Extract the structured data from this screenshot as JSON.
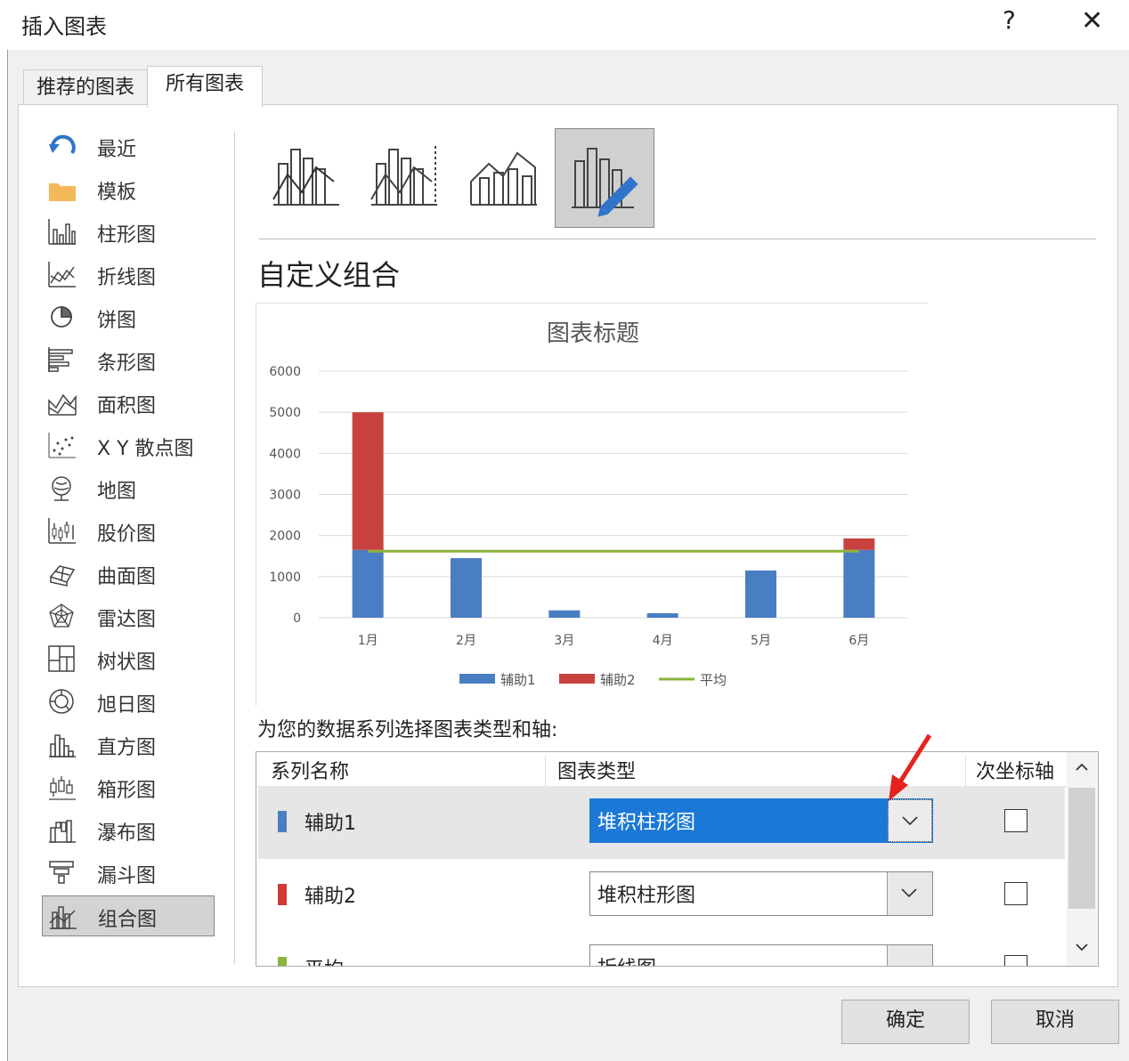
{
  "dialog": {
    "title": "插入图表",
    "help": "?",
    "close": "✕"
  },
  "tabs": [
    {
      "label": "推荐的图表"
    },
    {
      "label": "所有图表"
    }
  ],
  "sidebar": {
    "items": [
      {
        "label": "最近",
        "icon": "recent-icon"
      },
      {
        "label": "模板",
        "icon": "folder-icon"
      },
      {
        "label": "柱形图",
        "icon": "column-chart-icon"
      },
      {
        "label": "折线图",
        "icon": "line-chart-icon"
      },
      {
        "label": "饼图",
        "icon": "pie-chart-icon"
      },
      {
        "label": "条形图",
        "icon": "bar-chart-icon"
      },
      {
        "label": "面积图",
        "icon": "area-chart-icon"
      },
      {
        "label": "X Y 散点图",
        "icon": "scatter-chart-icon"
      },
      {
        "label": "地图",
        "icon": "map-icon"
      },
      {
        "label": "股价图",
        "icon": "stock-chart-icon"
      },
      {
        "label": "曲面图",
        "icon": "surface-chart-icon"
      },
      {
        "label": "雷达图",
        "icon": "radar-chart-icon"
      },
      {
        "label": "树状图",
        "icon": "treemap-icon"
      },
      {
        "label": "旭日图",
        "icon": "sunburst-icon"
      },
      {
        "label": "直方图",
        "icon": "histogram-icon"
      },
      {
        "label": "箱形图",
        "icon": "box-whisker-icon"
      },
      {
        "label": "瀑布图",
        "icon": "waterfall-icon"
      },
      {
        "label": "漏斗图",
        "icon": "funnel-icon"
      },
      {
        "label": "组合图",
        "icon": "combo-chart-icon",
        "selected": true
      }
    ]
  },
  "main": {
    "heading": "自定义组合",
    "instruction": "为您的数据系列选择图表类型和轴:",
    "selected_subtype": 4
  },
  "chart_data": {
    "type": "bar",
    "title": "图表标题",
    "categories": [
      "1月",
      "2月",
      "3月",
      "4月",
      "5月",
      "6月"
    ],
    "series": [
      {
        "name": "辅助1",
        "type": "stacked-bar",
        "color": "#4a7ec2",
        "values": [
          1650,
          1450,
          180,
          110,
          1150,
          1650
        ]
      },
      {
        "name": "辅助2",
        "type": "stacked-bar",
        "color": "#c8423d",
        "values": [
          3350,
          0,
          0,
          0,
          0,
          280
        ]
      },
      {
        "name": "平均",
        "type": "line",
        "color": "#8ab43c",
        "values": [
          1620,
          1620,
          1620,
          1620,
          1620,
          1620
        ]
      }
    ],
    "ylim": [
      0,
      6000
    ],
    "yticks": [
      "6000",
      "5000",
      "4000",
      "3000",
      "2000",
      "1000",
      "0"
    ],
    "grid": true,
    "legend": "bottom"
  },
  "series_table": {
    "headers": [
      "系列名称",
      "图表类型",
      "次坐标轴"
    ],
    "rows": [
      {
        "name": "辅助1",
        "color": "#4a7ec2",
        "type": "堆积柱形图",
        "secondary": false
      },
      {
        "name": "辅助2",
        "color": "#d03a34",
        "type": "堆积柱形图",
        "secondary": false
      },
      {
        "name": "平均",
        "color": "#8ab43c",
        "type": "折线图",
        "secondary": false
      }
    ]
  },
  "buttons": {
    "ok": "确定",
    "cancel": "取消"
  }
}
